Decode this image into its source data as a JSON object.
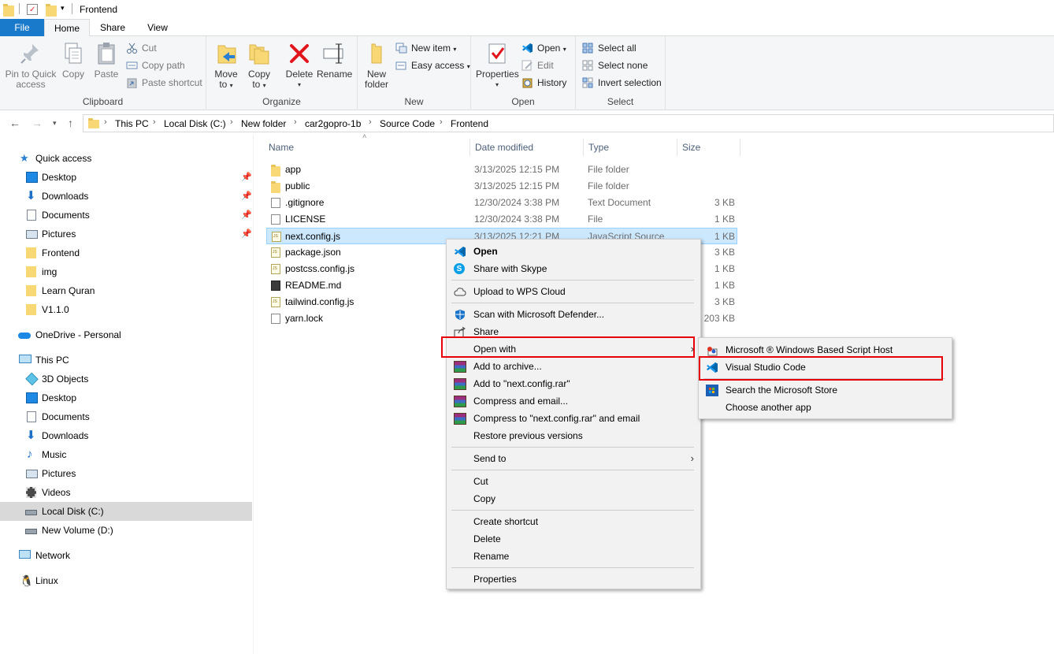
{
  "window": {
    "title": "Frontend"
  },
  "tabs": {
    "file": "File",
    "home": "Home",
    "share": "Share",
    "view": "View"
  },
  "ribbon": {
    "clipboard": {
      "label": "Clipboard",
      "pin_line1": "Pin to Quick",
      "pin_line2": "access",
      "copy": "Copy",
      "paste": "Paste",
      "cut": "Cut",
      "copy_path": "Copy path",
      "paste_shortcut": "Paste shortcut"
    },
    "organize": {
      "label": "Organize",
      "move_line1": "Move",
      "move_line2": "to",
      "copy_line1": "Copy",
      "copy_line2": "to",
      "delete": "Delete",
      "rename": "Rename"
    },
    "new": {
      "label": "New",
      "folder_line1": "New",
      "folder_line2": "folder",
      "new_item": "New item",
      "easy_access": "Easy access"
    },
    "open": {
      "label": "Open",
      "properties": "Properties",
      "open": "Open",
      "edit": "Edit",
      "history": "History"
    },
    "select": {
      "label": "Select",
      "select_all": "Select all",
      "select_none": "Select none",
      "invert": "Invert selection"
    }
  },
  "breadcrumb": [
    "This PC",
    "Local Disk (C:)",
    "New folder",
    "car2gopro-1b",
    "Source Code",
    "Frontend"
  ],
  "nav": {
    "quick_access": "Quick access",
    "quick_items": [
      "Desktop",
      "Downloads",
      "Documents",
      "Pictures",
      "Frontend",
      "img",
      "Learn Quran",
      "V1.1.0"
    ],
    "onedrive": "OneDrive - Personal",
    "this_pc": "This PC",
    "pc_items": [
      "3D Objects",
      "Desktop",
      "Documents",
      "Downloads",
      "Music",
      "Pictures",
      "Videos",
      "Local Disk (C:)",
      "New Volume (D:)"
    ],
    "network": "Network",
    "linux": "Linux"
  },
  "columns": {
    "name": "Name",
    "date": "Date modified",
    "type": "Type",
    "size": "Size"
  },
  "files": [
    {
      "name": "app",
      "date": "3/13/2025 12:15 PM",
      "type": "File folder",
      "size": ""
    },
    {
      "name": "public",
      "date": "3/13/2025 12:15 PM",
      "type": "File folder",
      "size": ""
    },
    {
      "name": ".gitignore",
      "date": "12/30/2024 3:38 PM",
      "type": "Text Document",
      "size": "3 KB"
    },
    {
      "name": "LICENSE",
      "date": "12/30/2024 3:38 PM",
      "type": "File",
      "size": "1 KB"
    },
    {
      "name": "next.config.js",
      "date": "3/13/2025 12:21 PM",
      "type": "JavaScript Source",
      "size": "1 KB"
    },
    {
      "name": "package.json",
      "date": "",
      "type": "",
      "size": "3 KB"
    },
    {
      "name": "postcss.config.js",
      "date": "",
      "type": "",
      "size": "1 KB"
    },
    {
      "name": "README.md",
      "date": "",
      "type": "",
      "size": "1 KB"
    },
    {
      "name": "tailwind.config.js",
      "date": "",
      "type": "",
      "size": "3 KB"
    },
    {
      "name": "yarn.lock",
      "date": "",
      "type": "",
      "size": "203 KB"
    }
  ],
  "context_menu": {
    "open": "Open",
    "share_skype": "Share with Skype",
    "upload_wps": "Upload to WPS Cloud",
    "scan_defender": "Scan with Microsoft Defender...",
    "share": "Share",
    "open_with": "Open with",
    "add_archive": "Add to archive...",
    "add_rar": "Add to \"next.config.rar\"",
    "compress_email": "Compress and email...",
    "compress_rar_email": "Compress to \"next.config.rar\" and email",
    "restore": "Restore previous versions",
    "send_to": "Send to",
    "cut": "Cut",
    "copy": "Copy",
    "create_shortcut": "Create shortcut",
    "delete": "Delete",
    "rename": "Rename",
    "properties": "Properties"
  },
  "open_with_menu": {
    "script_host": "Microsoft ® Windows Based Script Host",
    "vscode": "Visual Studio Code",
    "store": "Search the Microsoft Store",
    "another": "Choose another app"
  },
  "colors": {
    "accent": "#1979ca",
    "highlight": "#e8000b",
    "selection": "#cce8ff"
  }
}
